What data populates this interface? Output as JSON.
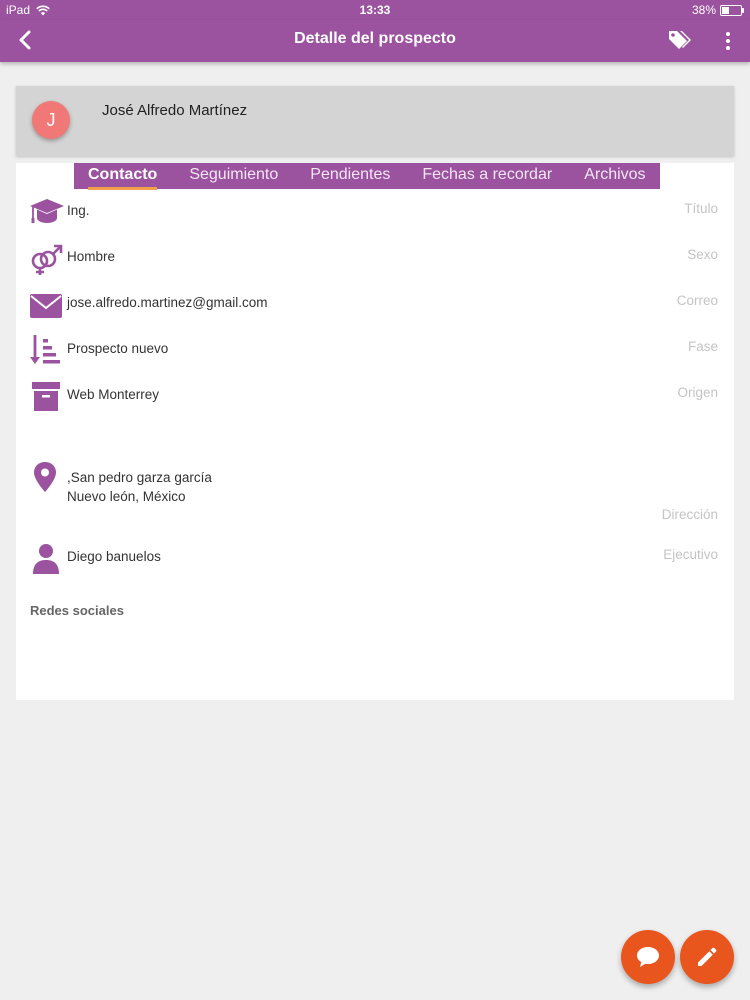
{
  "status_bar": {
    "device": "iPad",
    "time": "13:33",
    "battery": "38%",
    "battery_level": 0.38
  },
  "app_bar": {
    "title": "Detalle del prospecto"
  },
  "prospect": {
    "avatar_initial": "J",
    "name": "José Alfredo Martínez"
  },
  "tabs": [
    {
      "label": "Contacto",
      "active": true
    },
    {
      "label": "Seguimiento",
      "active": false
    },
    {
      "label": "Pendientes",
      "active": false
    },
    {
      "label": "Fechas a recordar",
      "active": false
    },
    {
      "label": "Archivos",
      "active": false
    }
  ],
  "fields": {
    "titulo": {
      "value": "Ing.",
      "label": "Título",
      "icon": "graduation-cap-icon"
    },
    "sexo": {
      "value": "Hombre",
      "label": "Sexo",
      "icon": "gender-icon"
    },
    "correo": {
      "value": "jose.alfredo.martinez@gmail.com",
      "label": "Correo",
      "icon": "envelope-icon"
    },
    "fase": {
      "value": "Prospecto nuevo",
      "label": "Fase",
      "icon": "sort-list-icon"
    },
    "origen": {
      "value": "Web Monterrey",
      "label": "Origen",
      "icon": "archive-box-icon"
    },
    "direccion": {
      "line1": ",San pedro garza garcía",
      "line2": "Nuevo león, México",
      "label": "Dirección",
      "icon": "location-pin-icon"
    },
    "ejecutivo": {
      "value": "Diego banuelos",
      "label": "Ejecutivo",
      "icon": "person-icon"
    }
  },
  "redes_sociales": "Redes sociales",
  "colors": {
    "primary": "#9b53a0",
    "accent": "#e8561e",
    "avatar": "#f07877",
    "tab_indicator": "#f0a14c"
  }
}
